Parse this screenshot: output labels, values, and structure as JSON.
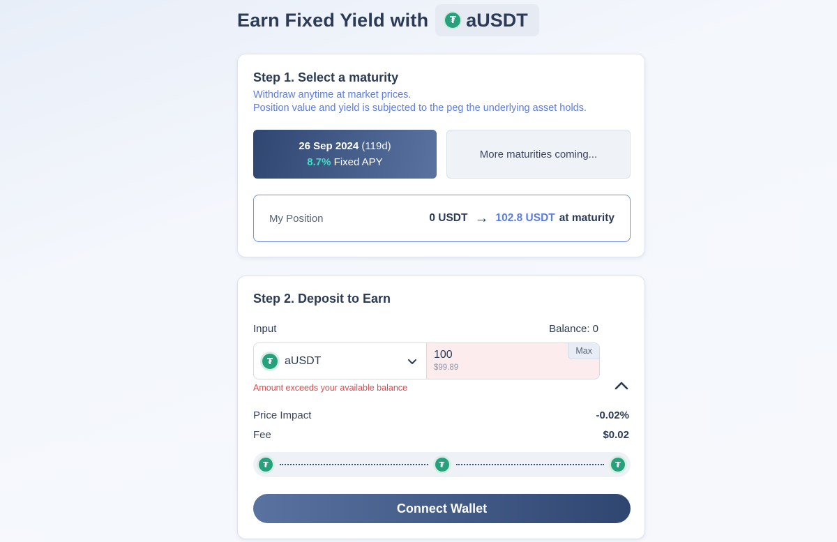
{
  "header": {
    "title": "Earn Fixed Yield with",
    "token": "aUSDT"
  },
  "step1": {
    "title": "Step 1. Select a maturity",
    "subtitle_line1": "Withdraw anytime at market prices.",
    "subtitle_line2": "Position value and yield is subjected to the peg the underlying asset holds.",
    "selected_maturity": {
      "date": "26 Sep 2024",
      "days": "(119d)",
      "apy": "8.7%",
      "apy_label": "Fixed APY"
    },
    "more_maturities": "More maturities coming...",
    "position": {
      "label": "My Position",
      "current": "0 USDT",
      "target": "102.8 USDT",
      "suffix": "at maturity"
    }
  },
  "step2": {
    "title": "Step 2. Deposit to Earn",
    "input_label": "Input",
    "balance": "Balance: 0",
    "token": "aUSDT",
    "amount": "100",
    "amount_usd": "$99.89",
    "max_label": "Max",
    "error": "Amount exceeds your available balance",
    "price_impact_label": "Price Impact",
    "price_impact_value": "-0.02%",
    "fee_label": "Fee",
    "fee_value": "$0.02",
    "route_tokens": [
      "tether-icon",
      "tether-icon",
      "tether-icon"
    ],
    "connect_label": "Connect Wallet"
  },
  "colors": {
    "accent_blue": "#5b7ce6",
    "apy_teal": "#3de0c4",
    "error_red": "#d94c4c",
    "tether_green": "#26a17b",
    "button_dark": "#2e4670"
  }
}
